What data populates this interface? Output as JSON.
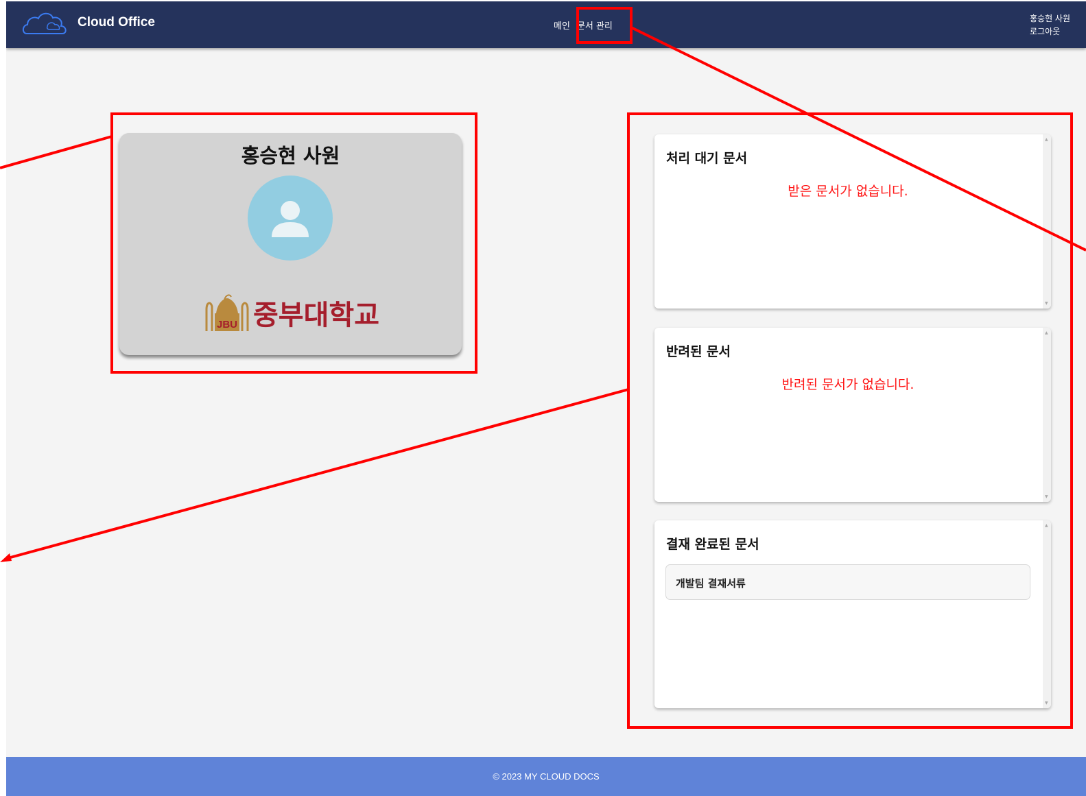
{
  "navbar": {
    "brand": "Cloud Office",
    "links": [
      "메인",
      "문서 관리"
    ],
    "user_name": "홍승현 사원",
    "logout": "로그아웃"
  },
  "profile": {
    "name": "홍승현 사원",
    "school": "중부대학교",
    "school_emblem_text": "JBU"
  },
  "panels": {
    "pending": {
      "title": "처리 대기 문서",
      "empty_message": "받은 문서가 없습니다."
    },
    "rejected": {
      "title": "반려된 문서",
      "empty_message": "반려된 문서가 없습니다."
    },
    "approved": {
      "title": "결재 완료된 문서",
      "items": [
        "개발팀 결재서류"
      ]
    }
  },
  "footer": {
    "text": "© 2023 MY CLOUD DOCS"
  },
  "colors": {
    "navbar": "#25335c",
    "background": "#f4f4f4",
    "footer": "#5f83d8",
    "empty_message": "#ff1515",
    "annotation": "#ff0000",
    "avatar": "#92cde1",
    "school": "#a51e2c"
  },
  "icons": [
    "cloud-logo-icon",
    "user-avatar-icon",
    "jbu-emblem-icon"
  ]
}
